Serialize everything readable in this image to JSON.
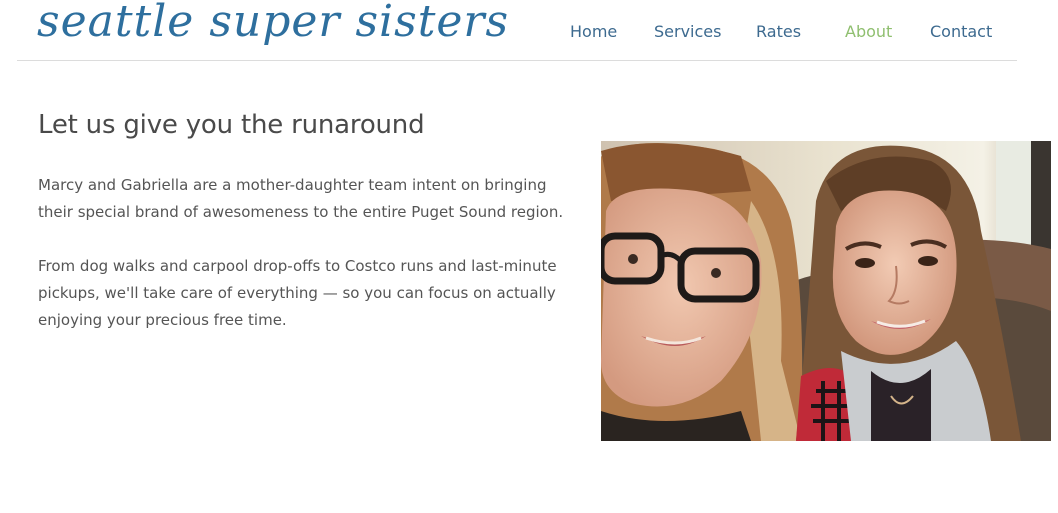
{
  "header": {
    "logo_text": "seattle super sisters",
    "nav": [
      {
        "label": "Home",
        "active": false
      },
      {
        "label": "Services",
        "active": false
      },
      {
        "label": "Rates",
        "active": false
      },
      {
        "label": "About",
        "active": true
      },
      {
        "label": "Contact",
        "active": false
      }
    ]
  },
  "main": {
    "heading": "Let us give you the runaround",
    "paragraphs": [
      "Marcy and Gabriella are a mother-daughter team intent on bringing their special brand of awesomeness to the entire Puget Sound region.",
      "From dog walks and carpool drop-offs to Costco runs and last-minute pickups, we'll take care of everything — so you can focus on actually enjoying your precious free time."
    ],
    "photo_subject": "selfie-of-mother-and-daughter"
  },
  "colors": {
    "logo": "#2e6f9e",
    "nav_link": "#3d6a8f",
    "nav_active": "#8fbf6f",
    "heading": "#4a4a4a",
    "body_text": "#555555",
    "divider": "#dcdcdc"
  }
}
